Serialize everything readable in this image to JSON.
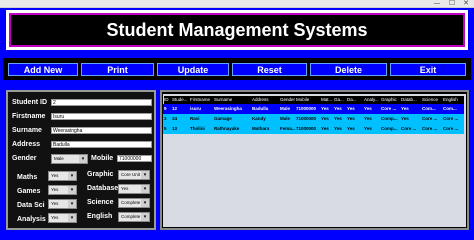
{
  "window": {
    "minimize": "—",
    "maximize": "☐",
    "close": "✕"
  },
  "header": {
    "title": "Student Management Systems"
  },
  "toolbar": {
    "add": "Add New",
    "print": "Print",
    "update": "Update",
    "reset": "Reset",
    "delete": "Delete",
    "exit": "Exit"
  },
  "form": {
    "student_id_label": "Student ID",
    "student_id": "2",
    "firstname_label": "Firstname",
    "firstname": "Isuru",
    "surname_label": "Surname",
    "surname": "Weerasingha",
    "address_label": "Address",
    "address": "Badulla",
    "gender_label": "Gender",
    "gender": "Male",
    "mobile_label": "Mobile",
    "mobile": "71000000",
    "maths_label": "Maths",
    "maths": "Yes",
    "graphic_label": "Graphic",
    "graphic": "Core Unit",
    "games_label": "Games",
    "games": "Yes",
    "database_label": "Database",
    "database": "Yes",
    "datasci_label": "Data Sci",
    "datasci": "Yes",
    "science_label": "Science",
    "science": "Complete",
    "analysis_label": "Analysis",
    "analysis": "Yes",
    "english_label": "English",
    "english": "Complete"
  },
  "table": {
    "columns": [
      "ID",
      "Stude...",
      "Firstname",
      "Surname",
      "Address",
      "Gender",
      "Mobile",
      "Mat...",
      "Ga...",
      "Da...",
      "Analy...",
      "Graphic",
      "Datab...",
      "Science",
      "English"
    ],
    "rows": [
      [
        "9",
        "12",
        "isuru",
        "Weerasingha",
        "Badulla",
        "Male",
        "71000000",
        "Yes",
        "Yes",
        "Yes",
        "Yes",
        "Core ...",
        "Yes",
        "Com...",
        "Com..."
      ],
      [
        "3",
        "34",
        "Ravi",
        "Gamage",
        "Kandy",
        "Male",
        "71000000",
        "Yes",
        "Yes",
        "Yes",
        "Yes",
        "Comp...",
        "Yes",
        "Core ...",
        "Core ..."
      ],
      [
        "5",
        "13",
        "Tholini",
        "Rathnayake",
        "Mathara",
        "Fema...",
        "71000000",
        "Yes",
        "Yes",
        "Yes",
        "Yes",
        "Comp...",
        "Core ...",
        "Core ...",
        "Core ..."
      ]
    ]
  },
  "colors": {
    "frame": "#0000ff",
    "button": "#0000ff",
    "selected_row": "#0000ff",
    "alt_row": "#00c0ff"
  }
}
